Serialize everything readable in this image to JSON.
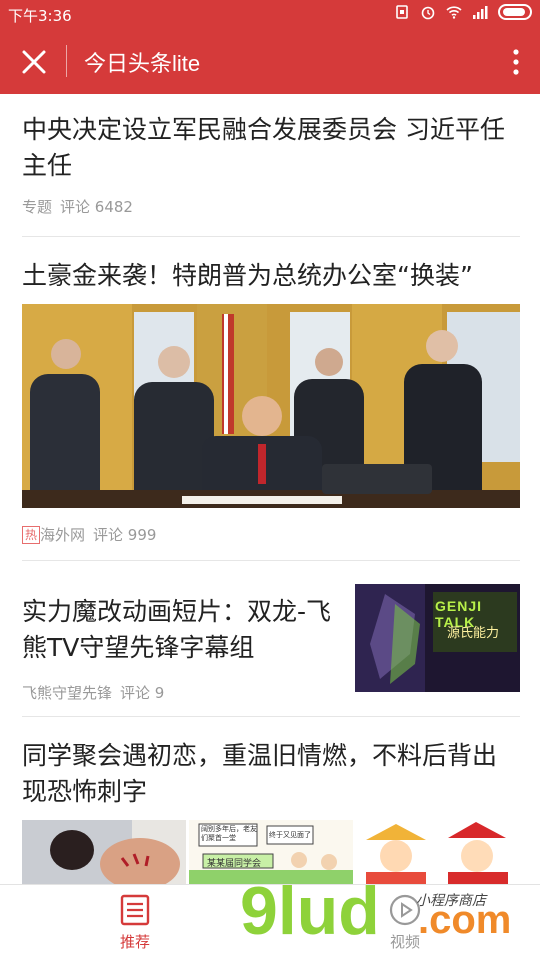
{
  "status_bar": {
    "time": "下午3:36"
  },
  "app_bar": {
    "title": "今日头条lite"
  },
  "articles": [
    {
      "headline": "中央决定设立军民融合发展委员会 习近平任主任",
      "source": "专题",
      "comments": "评论 6482"
    },
    {
      "headline": "土豪金来袭！特朗普为总统办公室“换装”",
      "hot_label": "热",
      "source": "海外网",
      "comments": "评论 999"
    },
    {
      "headline": "实力魔改动画短片：双龙-飞熊TV守望先锋字幕组",
      "source": "飞熊守望先锋",
      "comments": "评论 9",
      "thumb_text_1": "GENJI TALK",
      "thumb_text_2": "源氏能力"
    },
    {
      "headline": "同学聚会遇初恋，重温旧情燃，不料后背出现恐怖刺字",
      "comic_sign": "某某届同学会",
      "bubble_1": "阔别多年后，老友们聚首一堂",
      "bubble_2": "终于又见面了"
    }
  ],
  "bottom_nav": {
    "recommend": "推荐",
    "video": "视频"
  },
  "watermark": {
    "text": "9lud",
    "suffix": ".com",
    "script": "小程序商店"
  },
  "colors": {
    "brand_red": "#d53a3a",
    "meta_gray": "#999999"
  },
  "icons": {
    "close": "close-icon",
    "more": "more-vert-icon",
    "recommend": "news-icon",
    "video": "play-icon"
  }
}
